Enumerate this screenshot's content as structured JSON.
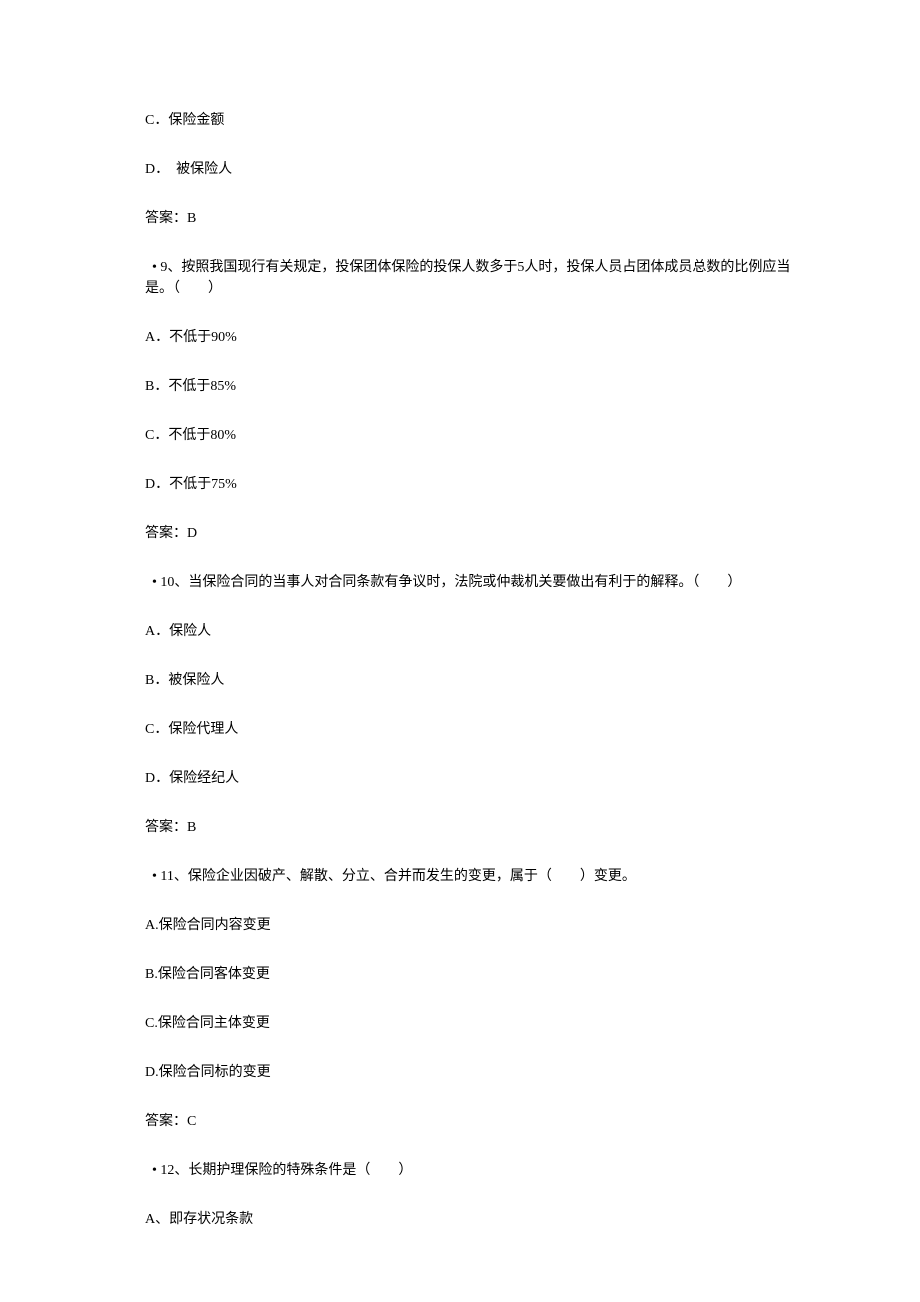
{
  "lines": [
    "C．保险金额",
    "D．  被保险人",
    "答案：B",
    "  • 9、按照我国现行有关规定，投保团体保险的投保人数多于5人时，投保人员占团体成员总数的比例应当是。（　　）",
    "A．不低于90%",
    "B．不低于85%",
    "C．不低于80%",
    "D．不低于75%",
    "答案：D",
    "  • 10、当保险合同的当事人对合同条款有争议时，法院或仲裁机关要做出有利于的解释。（　　）",
    "A．保险人",
    "B．被保险人",
    "C．保险代理人",
    "D．保险经纪人",
    "答案：B",
    "  • 11、保险企业因破产、解散、分立、合并而发生的变更，属于（　　）变更。",
    "A.保险合同内容变更",
    "B.保险合同客体变更",
    "C.保险合同主体变更",
    "D.保险合同标的变更",
    "答案：C",
    "  • 12、长期护理保险的特殊条件是（　　）",
    "A、即存状况条款"
  ]
}
